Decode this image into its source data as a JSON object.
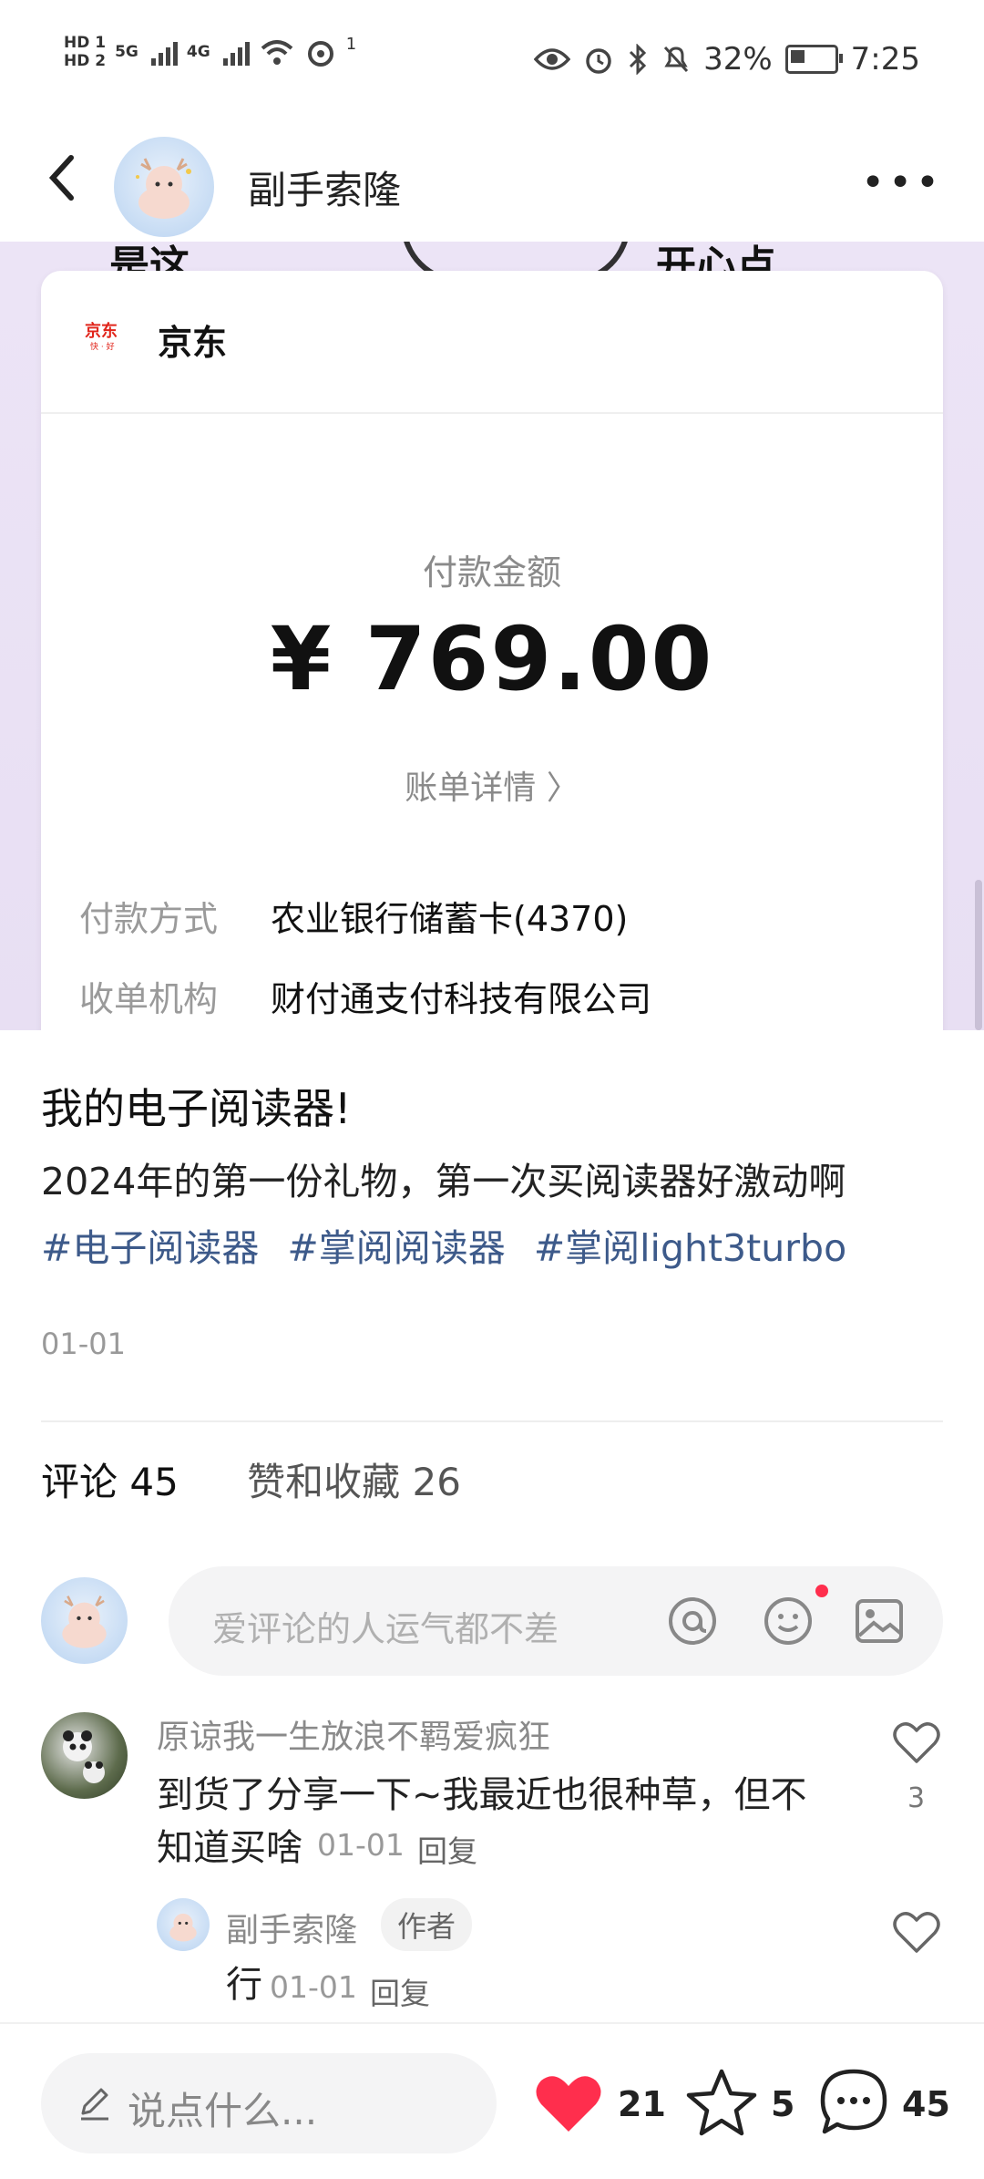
{
  "status_bar": {
    "hd1": "HD 1",
    "hd2": "HD 2",
    "net1": "5G",
    "net2": "4G",
    "hotspot_count": "1",
    "battery": "32%",
    "time": "7:25"
  },
  "header": {
    "username": "副手索隆",
    "more": "•••"
  },
  "receipt": {
    "shop": "京东",
    "amount_label": "付款金额",
    "amount": "¥ 769.00",
    "bill_detail": "账单详情 〉",
    "pay_method_label": "付款方式",
    "pay_method_value": "农业银行储蓄卡(4370)",
    "merchant_label": "收单机构",
    "merchant_value": "财付通支付科技有限公司",
    "doodle_left": "是这",
    "doodle_right": "开心点"
  },
  "post": {
    "title": "我的电子阅读器!",
    "description": "2024年的第一份礼物，第一次买阅读器好激动啊",
    "tags": [
      "#电子阅读器",
      "#掌阅阅读器",
      "#掌阅light3turbo"
    ],
    "date": "01-01"
  },
  "stats": {
    "comments": "评论 45",
    "likes_favs": "赞和收藏 26"
  },
  "comment_input": {
    "placeholder": "爱评论的人运气都不差"
  },
  "comments": [
    {
      "user": "原谅我一生放浪不羁爱疯狂",
      "text_line1": "到货了分享一下~我最近也很种草，但不",
      "text_line2": "知道买啥",
      "date": "01-01",
      "reply": "回复",
      "likes": "3"
    },
    {
      "user": "副手索隆",
      "badge": "作者",
      "text": "行",
      "date": "01-01",
      "reply": "回复"
    }
  ],
  "bottom_bar": {
    "say_placeholder": "说点什么...",
    "likes": "21",
    "stars": "5",
    "comments": "45"
  },
  "colors": {
    "accent_red": "#ff2e4d",
    "tag_blue": "#3d5a8a",
    "photo_bg": "#ece4f6"
  }
}
